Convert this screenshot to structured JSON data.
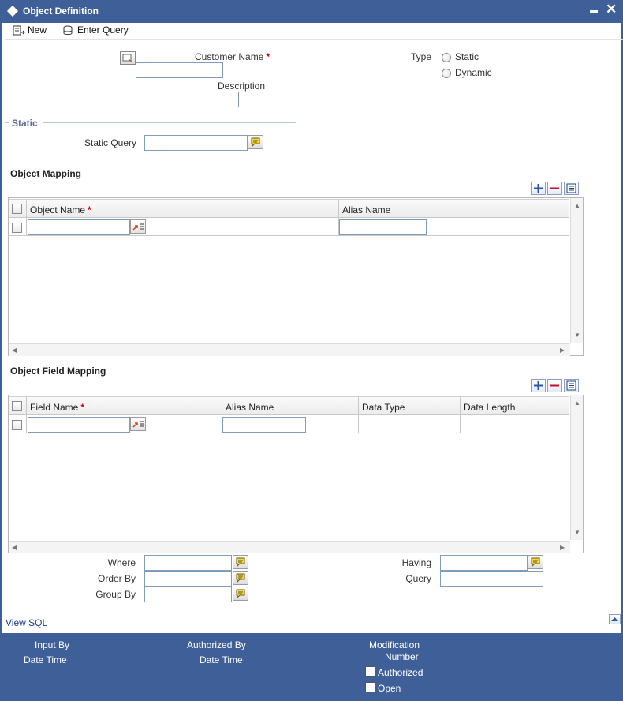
{
  "window": {
    "title": "Object Definition"
  },
  "toolbar": {
    "new_label": "New",
    "enter_query_label": "Enter Query"
  },
  "header": {
    "customer_name_label": "Customer Name",
    "customer_name_value": "",
    "description_label": "Description",
    "description_value": "",
    "type_label": "Type",
    "type_options": [
      "Static",
      "Dynamic"
    ],
    "required_mark": "*"
  },
  "static_section": {
    "title": "Static",
    "static_query_label": "Static Query",
    "static_query_value": ""
  },
  "object_mapping": {
    "title": "Object Mapping",
    "columns": [
      "Object Name",
      "Alias Name"
    ],
    "rows": [
      {
        "object_name": "",
        "alias_name": ""
      }
    ]
  },
  "object_field_mapping": {
    "title": "Object Field Mapping",
    "columns": [
      "Field Name",
      "Alias Name",
      "Data Type",
      "Data Length"
    ],
    "rows": [
      {
        "field_name": "",
        "alias_name": "",
        "data_type": "",
        "data_length": ""
      }
    ]
  },
  "clauses": {
    "where_label": "Where",
    "order_by_label": "Order By",
    "group_by_label": "Group By",
    "having_label": "Having",
    "query_label": "Query"
  },
  "view_sql_label": "View SQL",
  "footer": {
    "input_by_label": "Input By",
    "date_time_label_1": "Date Time",
    "authorized_by_label": "Authorized By",
    "date_time_label_2": "Date Time",
    "modification_label": "Modification",
    "number_label": "Number",
    "authorized_label": "Authorized",
    "open_label": "Open"
  },
  "colors": {
    "brand": "#3f5f99",
    "required": "#cc0000",
    "link": "#1a3f8a"
  }
}
